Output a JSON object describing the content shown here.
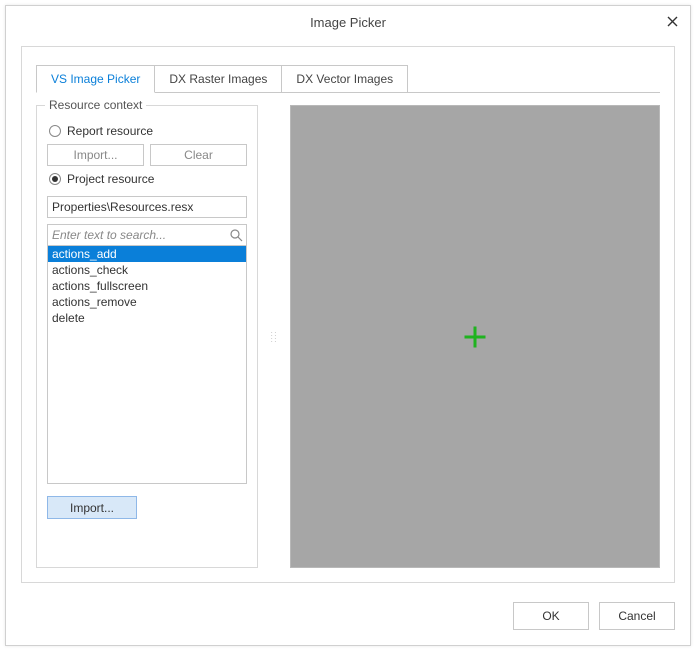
{
  "window": {
    "title": "Image Picker"
  },
  "tabs": [
    {
      "label": "VS Image Picker",
      "active": true
    },
    {
      "label": "DX Raster Images",
      "active": false
    },
    {
      "label": "DX Vector Images",
      "active": false
    }
  ],
  "resource_context": {
    "legend": "Resource context",
    "report_resource_label": "Report resource",
    "report_resource_checked": false,
    "import_disabled_label": "Import...",
    "clear_disabled_label": "Clear",
    "project_resource_label": "Project resource",
    "project_resource_checked": true,
    "resx_path": "Properties\\Resources.resx",
    "search_placeholder": "Enter text to search...",
    "items": [
      {
        "label": "actions_add",
        "selected": true
      },
      {
        "label": "actions_check",
        "selected": false
      },
      {
        "label": "actions_fullscreen",
        "selected": false
      },
      {
        "label": "actions_remove",
        "selected": false
      },
      {
        "label": "delete",
        "selected": false
      }
    ],
    "import_enabled_label": "Import..."
  },
  "preview": {
    "plus_color": "#1fb31f"
  },
  "footer": {
    "ok": "OK",
    "cancel": "Cancel"
  }
}
